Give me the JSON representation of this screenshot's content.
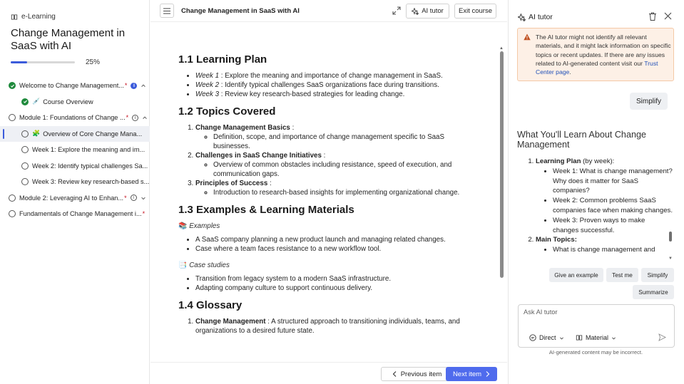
{
  "sidebar": {
    "brand": "e-Learning",
    "course_title": "Change Management in SaaS with AI",
    "progress_percent": 25,
    "progress_label": "25%",
    "items": [
      {
        "label": "Welcome to Change Management...",
        "required": "*"
      },
      {
        "label": "Course Overview",
        "emoji": "💉"
      },
      {
        "label": "Module 1: Foundations of Change ...",
        "required": "*"
      },
      {
        "label": "Overview of Core Change Mana...",
        "emoji": "🧩"
      },
      {
        "label": "Week 1: Explore the meaning and im..."
      },
      {
        "label": "Week 2: Identify typical challenges Sa..."
      },
      {
        "label": "Week 3: Review key research-based s..."
      },
      {
        "label": "Module 2: Leveraging AI to Enhan...",
        "required": "*"
      },
      {
        "label": "Fundamentals of Change Management i...",
        "required": "*"
      }
    ]
  },
  "topbar": {
    "doc_title": "Change Management in SaaS with AI",
    "ai_tutor_label": "AI tutor",
    "exit_label": "Exit course"
  },
  "article": {
    "s1_heading": "1.1 Learning Plan",
    "s1_items": [
      {
        "lead": "Week 1",
        "text": " : Explore the meaning and importance of change management in SaaS."
      },
      {
        "lead": "Week 2",
        "text": " : Identify typical challenges SaaS organizations face during transitions."
      },
      {
        "lead": "Week 3",
        "text": " : Review key research-based strategies for leading change."
      }
    ],
    "s2_heading": "1.2 Topics Covered",
    "s2_items": [
      {
        "title": "Change Management Basics",
        "sep": " :",
        "sub": "Definition, scope, and importance of change management specific to SaaS businesses."
      },
      {
        "title": "Challenges in SaaS Change Initiatives",
        "sep": " :",
        "sub": "Overview of common obstacles including resistance, speed of execution, and communication gaps."
      },
      {
        "title": "Principles of Success",
        "sep": " :",
        "sub": "Introduction to research-based insights for implementing organizational change."
      }
    ],
    "s3_heading": "1.3 Examples & Learning Materials",
    "examples_emoji": "📚",
    "examples_label": "Examples",
    "examples": [
      "A SaaS company planning a new product launch and managing related changes.",
      "Case where a team faces resistance to a new workflow tool."
    ],
    "case_emoji": "📑",
    "case_label": "Case studies",
    "cases": [
      "Transition from legacy system to a modern SaaS infrastructure.",
      "Adapting company culture to support continuous delivery."
    ],
    "s4_heading": "1.4 Glossary",
    "glossary_term": "Change Management",
    "glossary_text": " : A structured approach to transitioning individuals, teams, and organizations to a desired future state."
  },
  "footer": {
    "prev_label": "Previous item",
    "next_label": "Next item"
  },
  "tutor": {
    "title": "AI tutor",
    "warning_text": "The AI tutor might not identify all relevant materials, and it might lack information on specific topics or recent updates. If there are any issues related to AI-generated content visit our ",
    "warning_link": "Trust Center page",
    "warning_tail": ".",
    "user_message": "Simplify",
    "response_heading": "What You'll Learn About Change Management",
    "plan_label": "Learning Plan",
    "plan_suffix": " (by week):",
    "plan_items": [
      "Week 1: What is change management? Why does it matter for SaaS companies?",
      "Week 2: Common problems SaaS companies face when making changes.",
      "Week 3: Proven ways to make changes successful."
    ],
    "topics_label": "Main Topics:",
    "topics_items": [
      "What is change management and"
    ],
    "chips": {
      "example": "Give an example",
      "test": "Test me",
      "simplify": "Simplify",
      "summarize": "Summarize"
    },
    "ask_placeholder": "Ask AI tutor",
    "mode_label": "Direct",
    "source_label": "Material",
    "disclaimer": "AI-generated content may be incorrect."
  },
  "colors": {
    "accent": "#4f6bed",
    "progress": "#3b5bdb",
    "done": "#1f8a3c",
    "required": "#c50f1f",
    "warning_bg": "#fdf0e6"
  }
}
